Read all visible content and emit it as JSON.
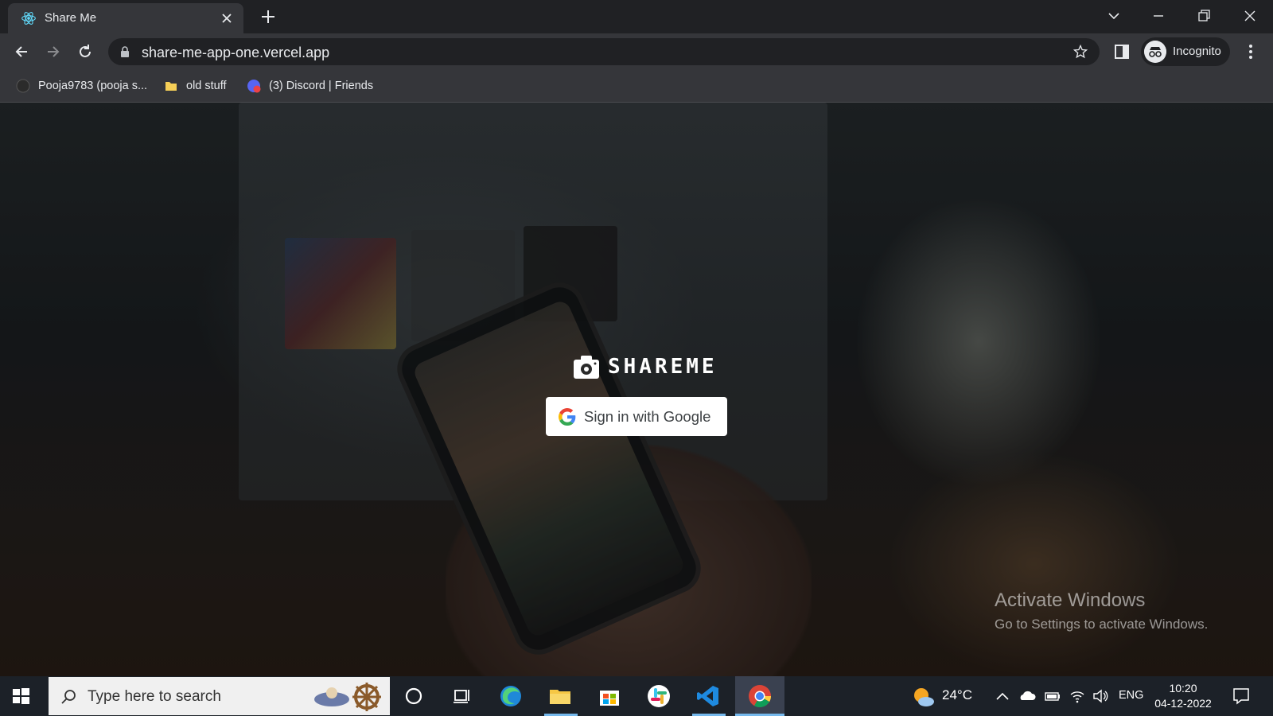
{
  "browser": {
    "tab": {
      "title": "Share Me"
    },
    "address": {
      "url": "share-me-app-one.vercel.app"
    },
    "profile": {
      "label": "Incognito"
    },
    "bookmarks": [
      {
        "label": "Pooja9783 (pooja s...",
        "icon": "github-icon"
      },
      {
        "label": "old stuff",
        "icon": "folder-icon"
      },
      {
        "label": "(3) Discord | Friends",
        "icon": "discord-icon"
      }
    ]
  },
  "page": {
    "brand": "SHAREME",
    "signin_label": "Sign in with Google"
  },
  "watermark": {
    "line1": "Activate Windows",
    "line2": "Go to Settings to activate Windows."
  },
  "taskbar": {
    "search_placeholder": "Type here to search",
    "weather": "24°C",
    "language": "ENG",
    "time": "10:20",
    "date": "04-12-2022",
    "pinned": [
      "cortana-icon",
      "task-view-icon",
      "edge-icon",
      "file-explorer-icon",
      "store-icon",
      "slack-icon",
      "vscode-icon",
      "chrome-icon"
    ]
  },
  "colors": {
    "accent": "#76b9ed",
    "google_blue": "#4285F4",
    "google_red": "#EA4335",
    "google_yellow": "#FBBC05",
    "google_green": "#34A853"
  }
}
